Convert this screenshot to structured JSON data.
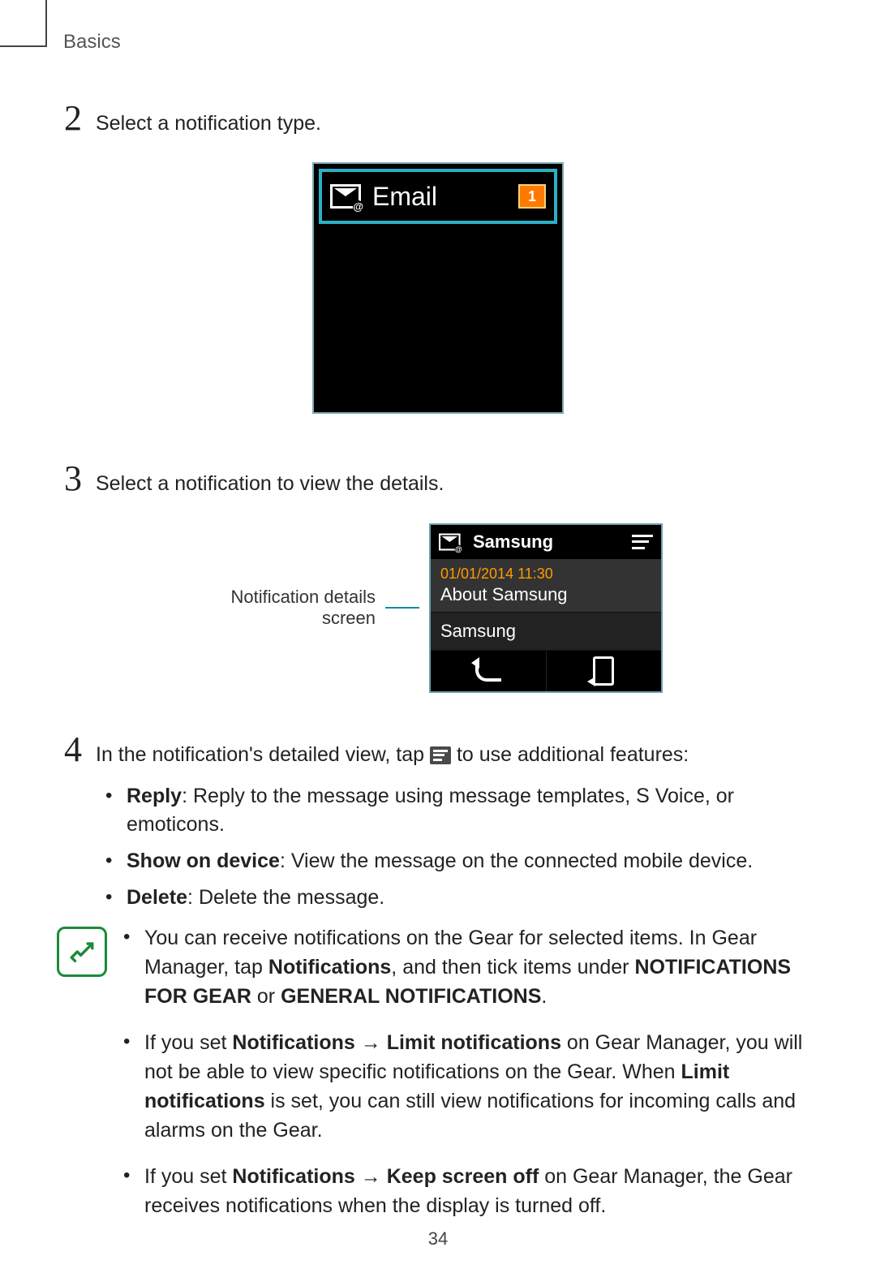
{
  "running_head": "Basics",
  "page_number": "34",
  "steps": {
    "s2": {
      "num": "2",
      "text": "Select a notification type."
    },
    "s3": {
      "num": "3",
      "text": "Select a notification to view the details."
    },
    "s4": {
      "num": "4",
      "text_before": "In the notification's detailed view, tap ",
      "text_after": " to use additional features:"
    }
  },
  "watch1": {
    "title": "Email",
    "badge": "1"
  },
  "callout": "Notification details screen",
  "watch2": {
    "sender_head": "Samsung",
    "date": "01/01/2014 11:30",
    "subject": "About Samsung",
    "sender_row": "Samsung"
  },
  "feature_items": {
    "reply_label": "Reply",
    "reply_desc": ": Reply to the message using message templates, S Voice, or emoticons.",
    "show_label": "Show on device",
    "show_desc": ": View the message on the connected mobile device.",
    "delete_label": "Delete",
    "delete_desc": ": Delete the message."
  },
  "notes": {
    "n1_a": "You can receive notifications on the Gear for selected items. In Gear Manager, tap ",
    "n1_b": "Notifications",
    "n1_c": ", and then tick items under ",
    "n1_d": "NOTIFICATIONS FOR GEAR",
    "n1_e": " or ",
    "n1_f": "GENERAL NOTIFICATIONS",
    "n1_g": ".",
    "n2_a": "If you set ",
    "n2_b": "Notifications",
    "n2_arrow": " → ",
    "n2_c": "Limit notifications",
    "n2_d": " on Gear Manager, you will not be able to view specific notifications on the Gear. When ",
    "n2_e": "Limit notifications",
    "n2_f": " is set, you can still view notifications for incoming calls and alarms on the Gear.",
    "n3_a": "If you set ",
    "n3_b": "Notifications",
    "n3_arrow": " → ",
    "n3_c": "Keep screen off",
    "n3_d": " on Gear Manager, the Gear receives notifications when the display is turned off."
  }
}
